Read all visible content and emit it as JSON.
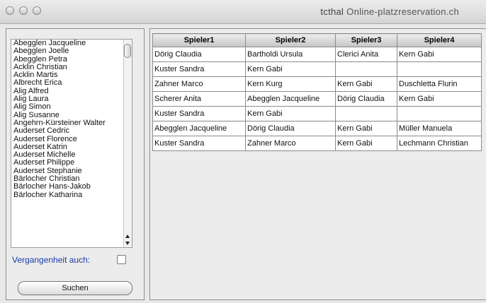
{
  "window": {
    "title_prefix": "tcthal",
    "title_host": "Online-platzreservation.ch"
  },
  "sidebar": {
    "names": [
      "Abegglen Jacqueline",
      "Abegglen Joelle",
      "Abegglen Petra",
      "Acklin Christian",
      "Acklin Martis",
      "Albrecht Erica",
      "Alig Alfred",
      "Alig Laura",
      "Alig Simon",
      "Alig Susanne",
      "Angehrn-Kürsteiner Walter",
      "Auderset Cedric",
      "Auderset Florence",
      "Auderset Katrin",
      "Auderset Michelle",
      "Auderset Philippe",
      "Auderset Stephanie",
      "Bärlocher Christian",
      "Bärlocher Hans-Jakob",
      "Bärlocher Katharina"
    ],
    "past_label": "Vergangenheit auch:",
    "past_checked": false,
    "search_label": "Suchen"
  },
  "table": {
    "headers": [
      "Spieler1",
      "Spieler2",
      "Spieler3",
      "Spieler4"
    ],
    "rows": [
      [
        "Dörig Claudia",
        "Bartholdi Ursula",
        "Clerici Anita",
        "Kern Gabi"
      ],
      [
        "Kuster Sandra",
        "Kern Gabi",
        "",
        ""
      ],
      [
        "Zahner Marco",
        "Kern Kurg",
        "Kern Gabi",
        "Duschletta Flurin"
      ],
      [
        "Scherer Anita",
        "Abegglen Jacqueline",
        "Dörig Claudia",
        "Kern Gabi"
      ],
      [
        "Kuster Sandra",
        "Kern Gabi",
        "",
        ""
      ],
      [
        "Abegglen Jacqueline",
        "Dörig Claudia",
        "Kern Gabi",
        "Müller Manuela"
      ],
      [
        "Kuster Sandra",
        "Zahner Marco",
        "Kern Gabi",
        "Lechmann Christian"
      ]
    ]
  }
}
